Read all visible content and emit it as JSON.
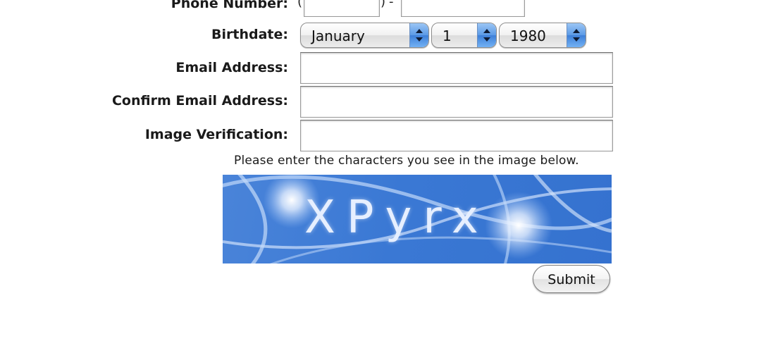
{
  "form": {
    "phone": {
      "label": "Phone Number:",
      "area_code_value": "",
      "number_value": "",
      "paren_open": "(",
      "paren_close": ")",
      "dash": "-"
    },
    "birthdate": {
      "label": "Birthdate:",
      "month": "January",
      "day": "1",
      "year": "1980"
    },
    "email": {
      "label": "Email Address:",
      "value": ""
    },
    "confirm_email": {
      "label": "Confirm Email Address:",
      "value": ""
    },
    "image_verification": {
      "label": "Image Verification:",
      "value": "",
      "instructions": "Please enter the characters you see in the image below.",
      "captcha_text": "XPyrx"
    },
    "submit_label": "Submit"
  },
  "colors": {
    "captcha_background": "#3a78d4",
    "select_arrow_accent": "#5b9ae6"
  }
}
